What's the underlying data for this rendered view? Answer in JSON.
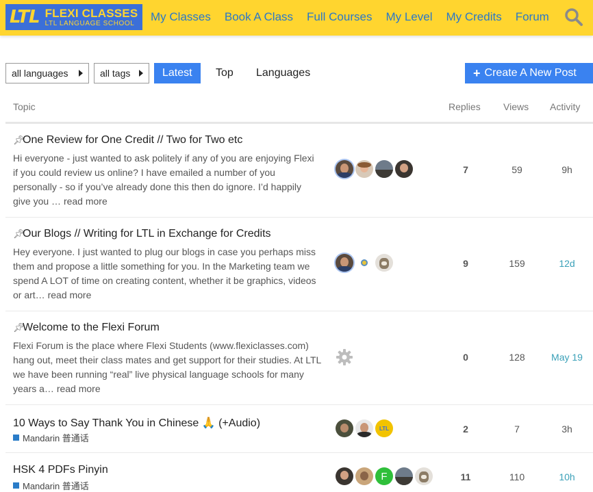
{
  "header": {
    "logo_mark": "LTL",
    "logo_title": "FLEXI CLASSES",
    "logo_subtitle": "LTL LANGUAGE SCHOOL",
    "nav": [
      "My Classes",
      "Book A Class",
      "Full Courses",
      "My Level",
      "My Credits",
      "Forum"
    ]
  },
  "controls": {
    "languages_dropdown": "all languages",
    "tags_dropdown": "all tags",
    "tabs": [
      "Latest",
      "Top",
      "Languages"
    ],
    "create_button": "Create A New Post"
  },
  "table_header": {
    "topic": "Topic",
    "replies": "Replies",
    "views": "Views",
    "activity": "Activity"
  },
  "topics": [
    {
      "title": "One Review for One Credit // Two for Two etc",
      "excerpt": "Hi everyone - just wanted to ask politely if any of you are enjoying Flexi if you could review us online? I have emailed a number of you personally - so if you’ve already done this then do ignore. I’d happily give you … ",
      "more": "read more",
      "replies": "7",
      "views": "59",
      "activity": "9h"
    },
    {
      "title": "Our Blogs // Writing for LTL in Exchange for Credits",
      "excerpt": "Hey everyone. I just wanted to plug our blogs in case you perhaps miss them and propose a little something for you. In the Marketing team we spend A LOT of time on creating content, whether it be graphics, videos or art… ",
      "more": "read more",
      "replies": "9",
      "views": "159",
      "activity": "12d"
    },
    {
      "title": "Welcome to the Flexi Forum",
      "excerpt": "Flexi Forum is the place where Flexi Students (www.flexiclasses.com) hang out, meet their class mates and get support for their studies. At LTL we have been running “real” live physical language schools for many years a… ",
      "more": "read more",
      "replies": "0",
      "views": "128",
      "activity": "May 19"
    },
    {
      "title": "10 Ways to Say Thank You in Chinese 🙏 (+Audio)",
      "category": "Mandarin 普通话",
      "replies": "2",
      "views": "7",
      "activity": "3h"
    },
    {
      "title": "HSK 4 PDFs Pinyin",
      "category": "Mandarin 普通话",
      "replies": "11",
      "views": "110",
      "activity": "10h"
    }
  ],
  "avatar_letters": {
    "ltl": "LTL",
    "f": "F"
  },
  "colors": {
    "header": "#ffd52f",
    "accent": "#3a82f0",
    "category": "#2a7cc8",
    "activity_recent": "#3aa0b8"
  }
}
